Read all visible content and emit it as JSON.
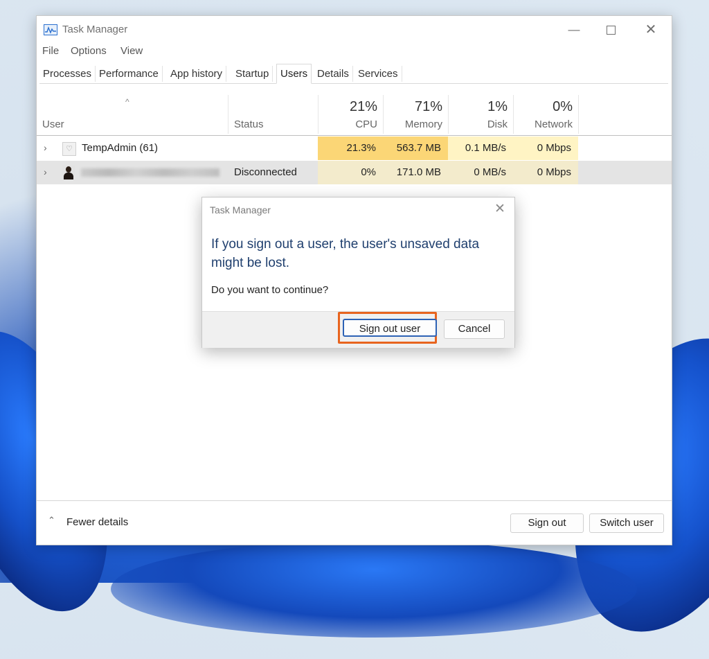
{
  "window": {
    "title": "Task Manager",
    "controls": {
      "minimize": "—",
      "close": "✕"
    }
  },
  "menu": [
    "File",
    "Options",
    "View"
  ],
  "tabs": [
    {
      "label": "Processes",
      "active": false
    },
    {
      "label": "Performance",
      "active": false
    },
    {
      "label": "App history",
      "active": false
    },
    {
      "label": "Startup",
      "active": false
    },
    {
      "label": "Users",
      "active": true
    },
    {
      "label": "Details",
      "active": false
    },
    {
      "label": "Services",
      "active": false
    }
  ],
  "table": {
    "sort_indicator": "^",
    "columns": {
      "user": "User",
      "status": "Status",
      "cpu": {
        "label": "CPU",
        "total": "21%"
      },
      "memory": {
        "label": "Memory",
        "total": "71%"
      },
      "disk": {
        "label": "Disk",
        "total": "1%"
      },
      "network": {
        "label": "Network",
        "total": "0%"
      }
    },
    "rows": [
      {
        "user": "TempAdmin (61)",
        "status": "",
        "cpu": "21.3%",
        "memory": "563.7 MB",
        "disk": "0.1 MB/s",
        "network": "0 Mbps"
      },
      {
        "user": "",
        "status": "Disconnected",
        "cpu": "0%",
        "memory": "171.0 MB",
        "disk": "0 MB/s",
        "network": "0 Mbps"
      }
    ]
  },
  "footer": {
    "fewer_details": "Fewer details",
    "sign_out": "Sign out",
    "switch_user": "Switch user"
  },
  "dialog": {
    "title": "Task Manager",
    "close": "✕",
    "heading": "If you sign out a user, the user's unsaved data might be lost.",
    "question": "Do you want to continue?",
    "confirm": "Sign out user",
    "cancel": "Cancel"
  },
  "colors": {
    "cpu_high": "#fbd676",
    "cell_light": "#fff4c4",
    "highlight_border": "#e8641e",
    "dialog_heading": "#1f3f6e"
  }
}
